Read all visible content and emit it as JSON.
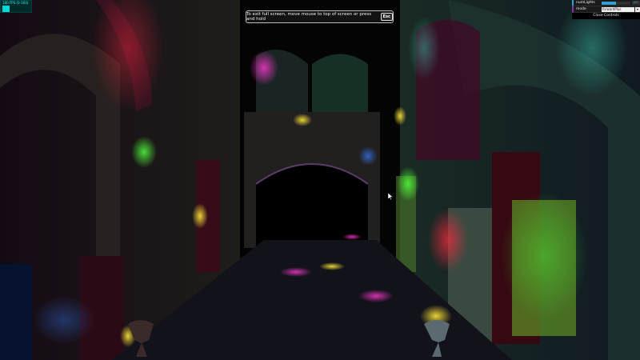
{
  "stats": {
    "label": "180 FPS (0-183)"
  },
  "banner": {
    "message": "To exit full screen, move mouse to top of screen or press and hold",
    "key": "Esc"
  },
  "gui": {
    "lights_label": "numLights",
    "lights_value": "100",
    "lights_fraction": 0.5,
    "mode_label": "mode",
    "mode_value": "forwardPlus",
    "close_label": "Close Controls"
  },
  "colors": {
    "accent": "#2fa1d6",
    "mode_accent": "#8c2eb0",
    "stats": "#00ffff"
  }
}
